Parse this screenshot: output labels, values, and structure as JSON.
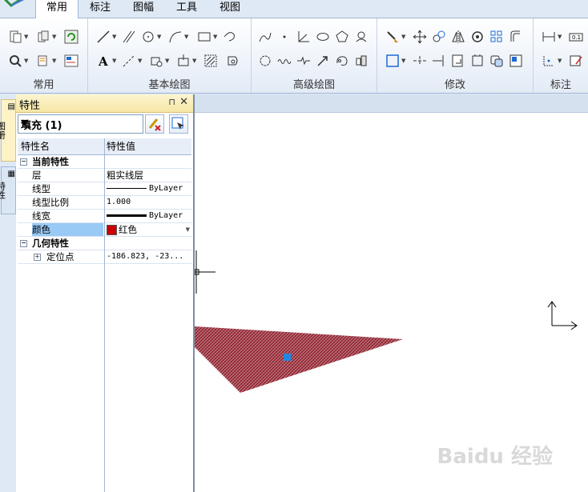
{
  "tabs": [
    {
      "label": "常用",
      "active": true
    },
    {
      "label": "标注",
      "active": false
    },
    {
      "label": "图幅",
      "active": false
    },
    {
      "label": "工具",
      "active": false
    },
    {
      "label": "视图",
      "active": false
    }
  ],
  "ribbon": {
    "groups": [
      {
        "label": "常用"
      },
      {
        "label": "基本绘图"
      },
      {
        "label": "高级绘图"
      },
      {
        "label": "修改"
      },
      {
        "label": "标注"
      }
    ]
  },
  "side_tabs": [
    "图册",
    "特性"
  ],
  "properties": {
    "title": "特性",
    "pin_glyph": "⊓",
    "close_glyph": "✕",
    "selection": "填充 (1)",
    "columns": {
      "name": "特性名",
      "value": "特性值"
    },
    "sections": [
      {
        "label": "当前特性",
        "rows": [
          {
            "name": "层",
            "value": "粗实线层"
          },
          {
            "name": "线型",
            "value": "ByLayer"
          },
          {
            "name": "线型比例",
            "value": "1.000"
          },
          {
            "name": "线宽",
            "value": "ByLayer"
          },
          {
            "name": "颜色",
            "value": "红色",
            "selected": true
          }
        ]
      },
      {
        "label": "几何特性",
        "rows": [
          {
            "name": "定位点",
            "value": "-186.823, -23..."
          }
        ]
      }
    ]
  },
  "colors": {
    "accent": "#99c9f5",
    "fill_red": "#cc0000",
    "hatch": "#a0303a",
    "grip": "#1e88e5"
  },
  "watermark": "Baidu 经验"
}
